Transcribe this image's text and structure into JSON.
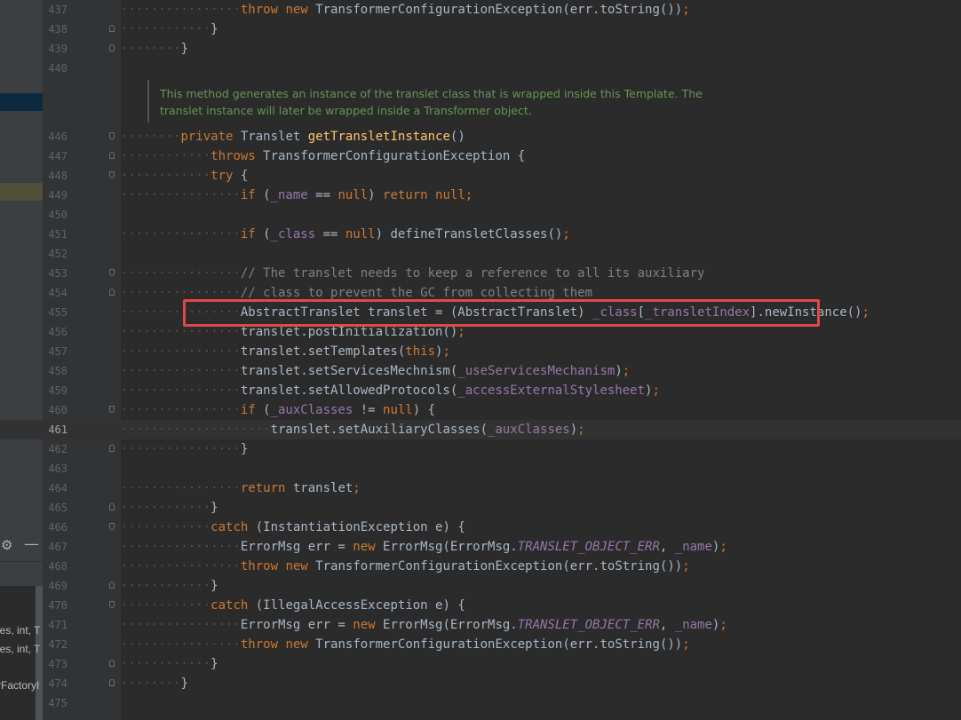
{
  "left_panel": {
    "text_rows": [
      "ies, int, T",
      "ies, int, T",
      "rFactoryI"
    ]
  },
  "editor": {
    "doc_comment": [
      "This method generates an instance of the translet class that is wrapped inside this Template. The",
      "translet instance will later be wrapped inside a Transformer object."
    ],
    "current_line": 461,
    "lines": [
      {
        "n": 437,
        "code": "                throw new TransformerConfigurationException(err.toString());"
      },
      {
        "n": 438,
        "code": "            }"
      },
      {
        "n": 439,
        "code": "        }"
      },
      {
        "n": 440,
        "code": ""
      },
      {
        "n": 446,
        "code": "        private Translet getTransletInstance()"
      },
      {
        "n": 447,
        "code": "            throws TransformerConfigurationException {"
      },
      {
        "n": 448,
        "code": "            try {"
      },
      {
        "n": 449,
        "code": "                if (_name == null) return null;"
      },
      {
        "n": 450,
        "code": ""
      },
      {
        "n": 451,
        "code": "                if (_class == null) defineTransletClasses();"
      },
      {
        "n": 452,
        "code": ""
      },
      {
        "n": 453,
        "code": "                // The translet needs to keep a reference to all its auxiliary"
      },
      {
        "n": 454,
        "code": "                // class to prevent the GC from collecting them"
      },
      {
        "n": 455,
        "code": "                AbstractTranslet translet = (AbstractTranslet) _class[_transletIndex].newInstance();"
      },
      {
        "n": 456,
        "code": "                translet.postInitialization();"
      },
      {
        "n": 457,
        "code": "                translet.setTemplates(this);"
      },
      {
        "n": 458,
        "code": "                translet.setServicesMechnism(_useServicesMechanism);"
      },
      {
        "n": 459,
        "code": "                translet.setAllowedProtocols(_accessExternalStylesheet);"
      },
      {
        "n": 460,
        "code": "                if (_auxClasses != null) {"
      },
      {
        "n": 461,
        "code": "                    translet.setAuxiliaryClasses(_auxClasses);"
      },
      {
        "n": 462,
        "code": "                }"
      },
      {
        "n": 463,
        "code": ""
      },
      {
        "n": 464,
        "code": "                return translet;"
      },
      {
        "n": 465,
        "code": "            }"
      },
      {
        "n": 466,
        "code": "            catch (InstantiationException e) {"
      },
      {
        "n": 467,
        "code": "                ErrorMsg err = new ErrorMsg(ErrorMsg.TRANSLET_OBJECT_ERR, _name);"
      },
      {
        "n": 468,
        "code": "                throw new TransformerConfigurationException(err.toString());"
      },
      {
        "n": 469,
        "code": "            }"
      },
      {
        "n": 470,
        "code": "            catch (IllegalAccessException e) {"
      },
      {
        "n": 471,
        "code": "                ErrorMsg err = new ErrorMsg(ErrorMsg.TRANSLET_OBJECT_ERR, _name);"
      },
      {
        "n": 472,
        "code": "                throw new TransformerConfigurationException(err.toString());"
      },
      {
        "n": 473,
        "code": "            }"
      },
      {
        "n": 474,
        "code": "        }"
      },
      {
        "n": 475,
        "code": ""
      }
    ]
  },
  "colors": {
    "keyword": "#cc7832",
    "method": "#ffc66d",
    "field": "#9876aa",
    "comment": "#808080",
    "doc": "#629755",
    "highlight_box": "#e0494a"
  }
}
